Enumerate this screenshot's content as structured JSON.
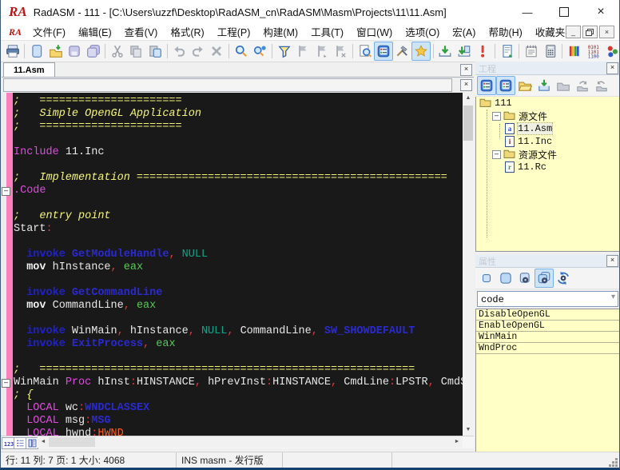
{
  "window": {
    "title": "RadASM - 111 - [C:\\Users\\uzzf\\Desktop\\RadASM_cn\\RadASM\\Masm\\Projects\\11\\11.Asm]",
    "control_icons": [
      "minimize",
      "maximize",
      "close"
    ],
    "mdi_control_icons": [
      "mdi-minimize",
      "mdi-restore",
      "mdi-close"
    ]
  },
  "menu": {
    "items": [
      "文件(F)",
      "编辑(E)",
      "查看(V)",
      "格式(R)",
      "工程(P)",
      "构建(M)",
      "工具(T)",
      "窗口(W)",
      "选项(O)",
      "宏(A)",
      "帮助(H)",
      "收藏夹"
    ]
  },
  "toolbar": {
    "groups": [
      [
        {
          "name": "print"
        }
      ],
      [
        {
          "name": "new"
        },
        {
          "name": "open"
        },
        {
          "name": "save"
        },
        {
          "name": "save-all"
        }
      ],
      [
        {
          "name": "cut",
          "state": "disabled"
        },
        {
          "name": "copy",
          "state": "disabled"
        },
        {
          "name": "paste"
        }
      ],
      [
        {
          "name": "undo",
          "state": "disabled"
        },
        {
          "name": "redo",
          "state": "disabled"
        },
        {
          "name": "delete",
          "state": "disabled"
        }
      ],
      [
        {
          "name": "find"
        },
        {
          "name": "replace"
        }
      ],
      [
        {
          "name": "filter"
        },
        {
          "name": "bookmark-toggle",
          "state": "disabled"
        },
        {
          "name": "bookmark-next",
          "state": "disabled"
        },
        {
          "name": "bookmark-clear",
          "state": "disabled"
        }
      ],
      [
        {
          "name": "find-in-files"
        },
        {
          "name": "project-options",
          "state": "active"
        },
        {
          "name": "tools"
        },
        {
          "name": "addin-manager",
          "state": "active"
        }
      ],
      [
        {
          "name": "build"
        },
        {
          "name": "build-all"
        },
        {
          "name": "run"
        }
      ],
      [
        {
          "name": "template"
        }
      ],
      [
        {
          "name": "notes"
        },
        {
          "name": "calculator"
        }
      ],
      [
        {
          "name": "palette"
        },
        {
          "name": "ascii-table"
        },
        {
          "name": "color-picker"
        }
      ]
    ]
  },
  "editor": {
    "tab": "11.Asm",
    "address_value": "",
    "fold_lines": [
      7,
      22
    ],
    "bottom_buttons": [
      "line-numbers",
      "bookmarks-list",
      "outline"
    ],
    "lines": [
      [
        [
          "cm",
          ";   ======================"
        ]
      ],
      [
        [
          "cm",
          ";   Simple OpenGL Application"
        ]
      ],
      [
        [
          "cm",
          ";   ======================"
        ]
      ],
      [],
      [
        [
          "kw",
          "Include"
        ],
        [
          "id",
          " 11.Inc"
        ]
      ],
      [],
      [
        [
          "cm",
          ";   Implementation ================================================"
        ]
      ],
      [
        [
          "kw",
          ".Code"
        ]
      ],
      [],
      [
        [
          "cm",
          ";   entry point"
        ]
      ],
      [
        [
          "id",
          "Start"
        ],
        [
          "pu",
          ":"
        ]
      ],
      [],
      [
        [
          "id",
          "  "
        ],
        [
          "iv",
          "invoke"
        ],
        [
          "ap",
          " GetModuleHandle"
        ],
        [
          "pu",
          ","
        ],
        [
          "ct",
          " NULL"
        ]
      ],
      [
        [
          "id",
          "  "
        ],
        [
          "mv",
          "mov"
        ],
        [
          "id",
          " hInstance"
        ],
        [
          "pu",
          ","
        ],
        [
          "rg",
          " eax"
        ]
      ],
      [],
      [
        [
          "id",
          "  "
        ],
        [
          "iv",
          "invoke"
        ],
        [
          "ap",
          " GetCommandLine"
        ]
      ],
      [
        [
          "id",
          "  "
        ],
        [
          "mv",
          "mov"
        ],
        [
          "id",
          " CommandLine"
        ],
        [
          "pu",
          ","
        ],
        [
          "rg",
          " eax"
        ]
      ],
      [],
      [
        [
          "id",
          "  "
        ],
        [
          "iv",
          "invoke"
        ],
        [
          "id",
          " WinMain"
        ],
        [
          "pu",
          ","
        ],
        [
          "id",
          " hInstance"
        ],
        [
          "pu",
          ","
        ],
        [
          "ct",
          " NULL"
        ],
        [
          "pu",
          ","
        ],
        [
          "id",
          " CommandLine"
        ],
        [
          "pu",
          ","
        ],
        [
          "ap",
          " SW_SHOWDEFAULT"
        ]
      ],
      [
        [
          "id",
          "  "
        ],
        [
          "iv",
          "invoke"
        ],
        [
          "ap",
          " ExitProcess"
        ],
        [
          "pu",
          ","
        ],
        [
          "rg",
          " eax"
        ]
      ],
      [],
      [
        [
          "cm",
          ";   =========================================================="
        ]
      ],
      [
        [
          "id",
          "WinMain "
        ],
        [
          "kw",
          "Proc"
        ],
        [
          "id",
          " hInst"
        ],
        [
          "pu",
          ":"
        ],
        [
          "id",
          "HINSTANCE"
        ],
        [
          "pu",
          ","
        ],
        [
          "id",
          " hPrevInst"
        ],
        [
          "pu",
          ":"
        ],
        [
          "id",
          "HINSTANCE"
        ],
        [
          "pu",
          ","
        ],
        [
          "id",
          " CmdLine"
        ],
        [
          "pu",
          ":"
        ],
        [
          "id",
          "LPSTR"
        ],
        [
          "pu",
          ","
        ],
        [
          "id",
          " CmdS"
        ]
      ],
      [
        [
          "cm",
          "; {"
        ]
      ],
      [
        [
          "id",
          "  "
        ],
        [
          "kw",
          "LOCAL"
        ],
        [
          "id",
          " wc"
        ],
        [
          "pu",
          ":"
        ],
        [
          "ap",
          "WNDCLASSEX"
        ]
      ],
      [
        [
          "id",
          "  "
        ],
        [
          "kw",
          "LOCAL"
        ],
        [
          "id",
          " msg"
        ],
        [
          "pu",
          ":"
        ],
        [
          "ap",
          "MSG"
        ]
      ],
      [
        [
          "id",
          "  "
        ],
        [
          "kw",
          "LOCAL"
        ],
        [
          "id",
          " hwnd"
        ],
        [
          "pu",
          ":"
        ],
        [
          "hw",
          "HWND"
        ]
      ]
    ]
  },
  "project_panel": {
    "title": "工程",
    "toolbar": [
      {
        "name": "view-list",
        "state": "active"
      },
      {
        "name": "view-details",
        "state": "active"
      },
      {
        "name": "open-folder"
      },
      {
        "name": "add-file"
      },
      {
        "name": "new-folder",
        "state": "disabled"
      },
      {
        "name": "sync-in",
        "state": "disabled"
      },
      {
        "name": "sync-out",
        "state": "disabled"
      }
    ],
    "tree": [
      {
        "label": "111",
        "icon": "folder",
        "level": 0
      },
      {
        "label": "源文件",
        "icon": "folder",
        "level": 1,
        "expander": "minus"
      },
      {
        "label": "11.Asm",
        "icon": "file-a",
        "level": 2,
        "selected": true
      },
      {
        "label": "11.Inc",
        "icon": "file-i",
        "level": 2
      },
      {
        "label": "资源文件",
        "icon": "folder",
        "level": 1,
        "expander": "minus"
      },
      {
        "label": "11.Rc",
        "icon": "file-r",
        "level": 2
      }
    ]
  },
  "properties_panel": {
    "title": "属性",
    "toolbar": [
      {
        "name": "item-small"
      },
      {
        "name": "item-large"
      },
      {
        "name": "procs-doc"
      },
      {
        "name": "procs-all",
        "state": "active"
      },
      {
        "name": "refresh"
      }
    ],
    "combo_value": "code",
    "items": [
      "DisableOpenGL",
      "EnableOpenGL",
      "WinMain",
      "WndProc"
    ]
  },
  "statusbar": {
    "cells": [
      "行: 11 列: 7 页: 1 大小: 4068",
      "INS masm - 发行版",
      "",
      ""
    ]
  },
  "colors": {
    "editor_bg": "#191919",
    "margin_pink": "#ff7fbe",
    "panel_yellow": "#ffffc6",
    "comment_yellow": "#f5f57a",
    "keyword_magenta": "#e14ae1",
    "api_blue": "#2a2ad0",
    "punct_red": "#e23b3b",
    "register_green": "#58c858",
    "const_teal": "#12a287",
    "hwnd_orange": "#ff5f1f",
    "active_toggle": "#cde3f8"
  }
}
